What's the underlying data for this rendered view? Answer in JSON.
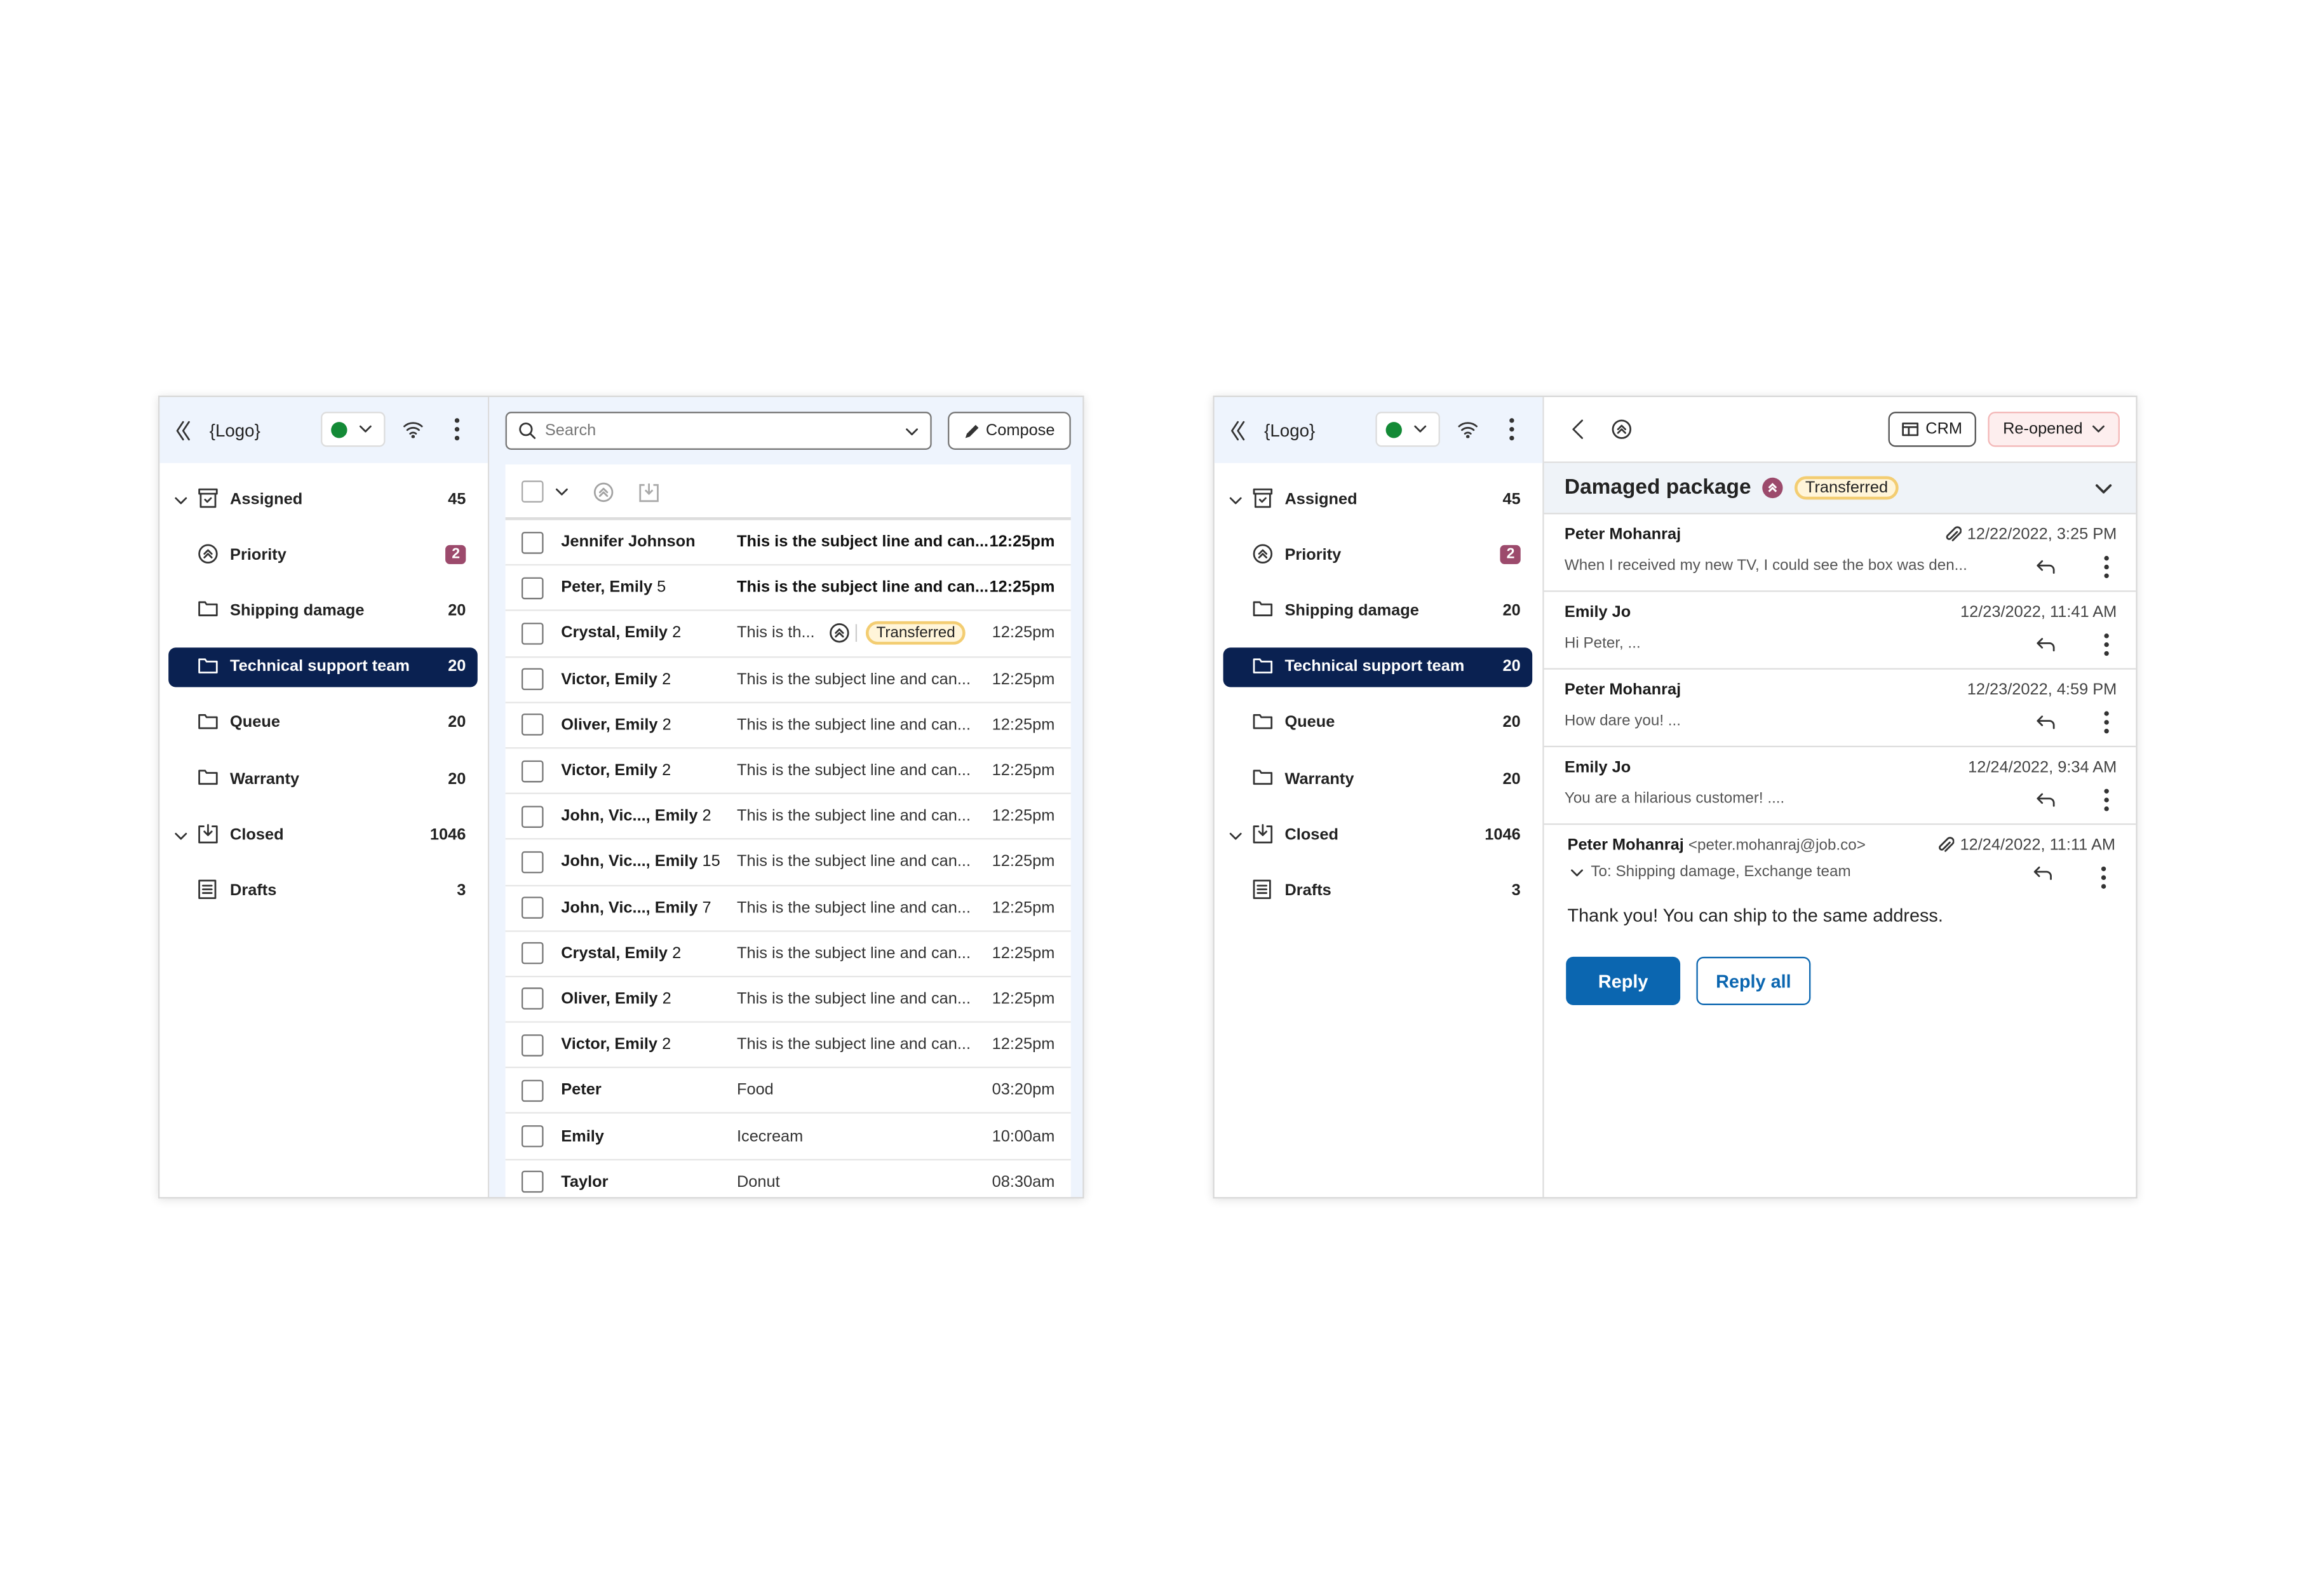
{
  "colors": {
    "accent": "#0b66b0",
    "sidebar_active": "#0a2151",
    "priority": "#9c4a6c",
    "status_online": "#138a36",
    "transferred_border": "#f3cd72"
  },
  "sidebar": {
    "logo": "{Logo}",
    "items": [
      {
        "label": "Assigned",
        "count": "45",
        "icon": "assigned-icon",
        "chevron": true
      },
      {
        "label": "Priority",
        "count": "2",
        "icon": "priority-icon",
        "badge": true
      },
      {
        "label": "Shipping damage",
        "count": "20",
        "icon": "folder-icon"
      },
      {
        "label": "Technical support team",
        "count": "20",
        "icon": "folder-icon",
        "active": true
      },
      {
        "label": "Queue",
        "count": "20",
        "icon": "folder-icon"
      },
      {
        "label": "Warranty",
        "count": "20",
        "icon": "folder-icon"
      },
      {
        "label": "Closed",
        "count": "1046",
        "icon": "closed-icon",
        "chevron": true
      },
      {
        "label": "Drafts",
        "count": "3",
        "icon": "drafts-icon"
      }
    ]
  },
  "inbox": {
    "search_placeholder": "Search",
    "compose_label": "Compose",
    "rows": [
      {
        "from": "Jennifer Johnson",
        "n": "",
        "subject": "This is the subject line and can...",
        "time": "12:25pm",
        "unread": true
      },
      {
        "from": "Peter, Emily",
        "n": "5",
        "subject": "This is the subject line and can...",
        "time": "12:25pm",
        "unread": true
      },
      {
        "from": "Crystal, Emily",
        "n": "2",
        "subject": "This is th...",
        "time": "12:25pm",
        "tag": "Transferred"
      },
      {
        "from": "Victor, Emily",
        "n": "2",
        "subject": "This is the subject line and can...",
        "time": "12:25pm"
      },
      {
        "from": "Oliver, Emily",
        "n": "2",
        "subject": "This is the subject line and can...",
        "time": "12:25pm"
      },
      {
        "from": "Victor, Emily",
        "n": "2",
        "subject": "This is the subject line and can...",
        "time": "12:25pm"
      },
      {
        "from": "John, Vic..., Emily",
        "n": "2",
        "subject": "This is the subject line and can...",
        "time": "12:25pm"
      },
      {
        "from": "John, Vic..., Emily",
        "n": "15",
        "subject": "This is the subject line and can...",
        "time": "12:25pm"
      },
      {
        "from": "John, Vic..., Emily",
        "n": "7",
        "subject": "This is the subject line and can...",
        "time": "12:25pm"
      },
      {
        "from": "Crystal, Emily",
        "n": "2",
        "subject": "This is the subject line and can...",
        "time": "12:25pm"
      },
      {
        "from": "Oliver, Emily",
        "n": "2",
        "subject": "This is the subject line and can...",
        "time": "12:25pm"
      },
      {
        "from": "Victor, Emily",
        "n": "2",
        "subject": "This is the subject line and can...",
        "time": "12:25pm"
      },
      {
        "from": "Peter",
        "n": "",
        "subject": "Food",
        "time": "03:20pm"
      },
      {
        "from": "Emily",
        "n": "",
        "subject": "Icecream",
        "time": "10:00am"
      },
      {
        "from": "Taylor",
        "n": "",
        "subject": "Donut",
        "time": "08:30am"
      }
    ]
  },
  "detail": {
    "crm_label": "CRM",
    "status_label": "Re-opened",
    "title": "Damaged package",
    "tag": "Transferred",
    "messages": [
      {
        "from": "Peter Mohanraj",
        "date": "12/22/2022, 3:25 PM",
        "preview": "When I received my new TV, I could see the box was den...",
        "attachment": true
      },
      {
        "from": "Emily Jo",
        "date": "12/23/2022, 11:41 AM",
        "preview": "Hi Peter, ..."
      },
      {
        "from": "Peter Mohanraj",
        "date": "12/23/2022, 4:59 PM",
        "preview": "How dare you! ..."
      },
      {
        "from": "Emily Jo",
        "date": "12/24/2022, 9:34 AM",
        "preview": "You are a hilarious customer! ...."
      }
    ],
    "expanded": {
      "from": "Peter Mohanraj",
      "email": "<peter.mohanraj@job.co>",
      "date": "12/24/2022, 11:11 AM",
      "to": "To: Shipping damage, Exchange team",
      "body": "Thank you! You can ship to the same address.",
      "reply_label": "Reply",
      "reply_all_label": "Reply all"
    }
  }
}
